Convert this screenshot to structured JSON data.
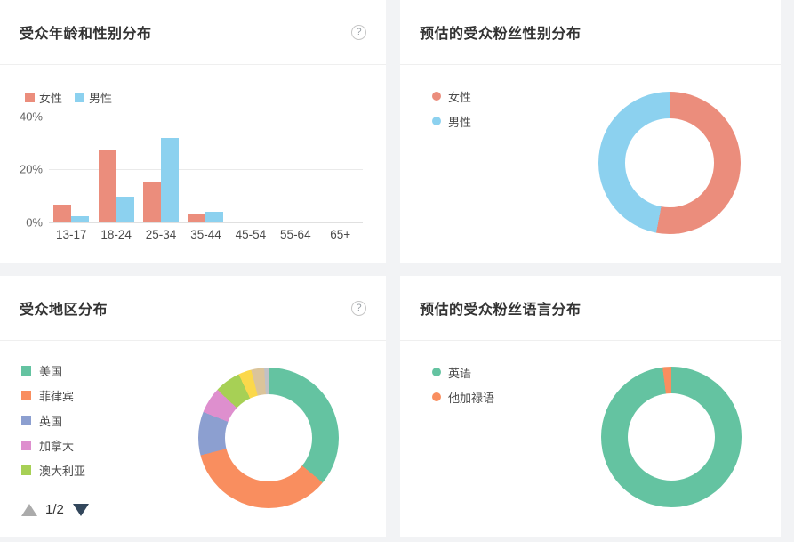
{
  "icons": {
    "help_glyph": "?"
  },
  "colors": {
    "female": "#eb8d7c",
    "male": "#8cd1ef",
    "green": "#64c3a1",
    "orange": "#f98e5f",
    "periwinkle": "#8c9fd0",
    "pink": "#de8fce",
    "yellow_green": "#a7d055",
    "yellow": "#fbd84b",
    "tan": "#dbc49a",
    "gray": "#c1c1c5",
    "page_background": "#f2f3f5",
    "card_background": "#ffffff"
  },
  "cards": {
    "region": {
      "pagination": {
        "current": "1/2"
      }
    }
  },
  "chart_data": [
    {
      "id": "age_gender",
      "type": "bar",
      "title": "受众年龄和性别分布",
      "categories": [
        "13-17",
        "18-24",
        "25-34",
        "35-44",
        "45-54",
        "55-64",
        "65+"
      ],
      "series": [
        {
          "name": "女性",
          "color": "#eb8d7c",
          "values": [
            6.7,
            27.5,
            15,
            3.5,
            0.4,
            0,
            0
          ]
        },
        {
          "name": "男性",
          "color": "#8cd1ef",
          "values": [
            2.3,
            9.7,
            32,
            3.9,
            0.4,
            0,
            0
          ]
        }
      ],
      "ylabel": "",
      "xlabel": "",
      "ylim": [
        0,
        40
      ],
      "yticks": [
        "40%",
        "20%",
        "0%"
      ],
      "grid": true,
      "legend_position": "top-left",
      "legend_marker": "square"
    },
    {
      "id": "gender",
      "type": "pie",
      "title": "预估的受众粉丝性别分布",
      "donut": true,
      "segments": [
        {
          "label": "女性",
          "value": 53,
          "color": "#eb8d7c"
        },
        {
          "label": "男性",
          "value": 47,
          "color": "#8cd1ef"
        }
      ],
      "legend_position": "left",
      "legend_marker": "dot"
    },
    {
      "id": "region",
      "type": "pie",
      "title": "受众地区分布",
      "donut": true,
      "segments": [
        {
          "label": "美国",
          "value": 36,
          "color": "#64c3a1"
        },
        {
          "label": "菲律宾",
          "value": 35,
          "color": "#f98e5f"
        },
        {
          "label": "英国",
          "value": 10,
          "color": "#8c9fd0"
        },
        {
          "label": "加拿大",
          "value": 6,
          "color": "#de8fce"
        },
        {
          "label": "澳大利亚",
          "value": 6,
          "color": "#a7d055"
        },
        {
          "label": "",
          "value": 3,
          "color": "#fbd84b"
        },
        {
          "label": "",
          "value": 3,
          "color": "#dbc49a"
        },
        {
          "label": "",
          "value": 1,
          "color": "#c1c1c5"
        }
      ],
      "legend_position": "left",
      "legend_marker": "square",
      "legend_visible_count": 5
    },
    {
      "id": "language",
      "type": "pie",
      "title": "预估的受众粉丝语言分布",
      "donut": true,
      "segments": [
        {
          "label": "英语",
          "value": 98,
          "color": "#64c3a1"
        },
        {
          "label": "他加禄语",
          "value": 2,
          "color": "#f98e5f"
        }
      ],
      "legend_position": "left",
      "legend_marker": "dot"
    }
  ]
}
